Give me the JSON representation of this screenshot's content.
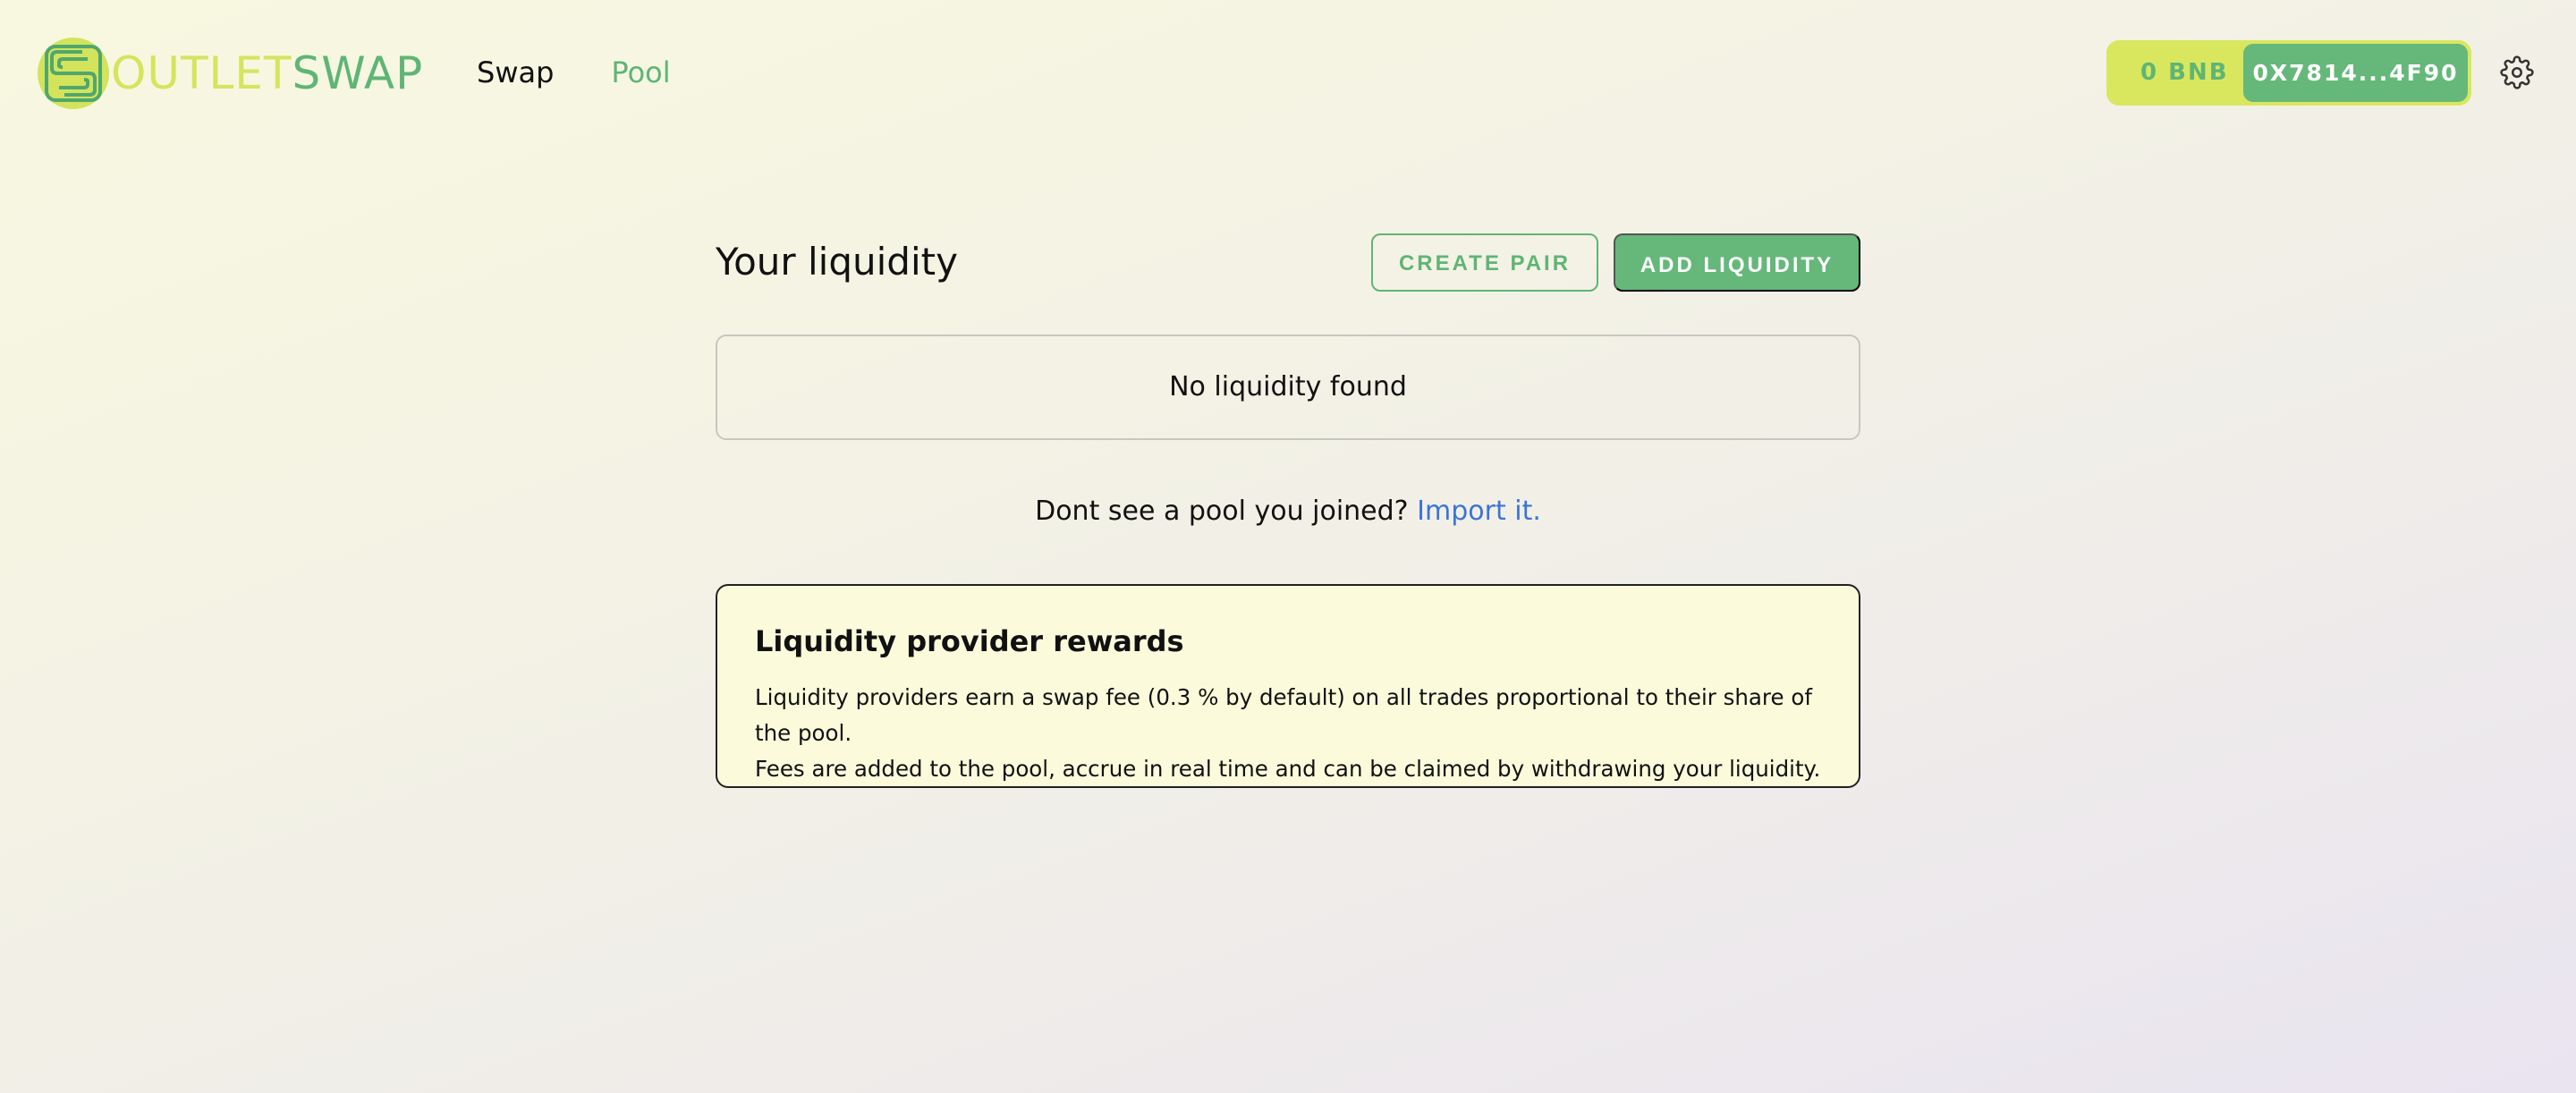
{
  "header": {
    "logo_text_part1": "OUTLET",
    "logo_text_part2": "SWAP",
    "nav": [
      {
        "label": "Swap",
        "active": false
      },
      {
        "label": "Pool",
        "active": true
      }
    ],
    "wallet": {
      "balance": "0 BNB",
      "address": "0X7814...4F90"
    },
    "settings_icon": "gear-icon"
  },
  "main": {
    "title": "Your liquidity",
    "create_pair_label": "CREATE PAIR",
    "add_liquidity_label": "ADD LIQUIDITY",
    "empty_text": "No liquidity found",
    "import_prompt": "Dont see a pool you joined?",
    "import_link": "Import it.",
    "rewards": {
      "title": "Liquidity provider rewards",
      "line1": "Liquidity providers earn a swap fee (0.3 % by default) on all trades proportional to their share of the pool.",
      "line2": "Fees are added to the pool, accrue in real time and can be claimed by withdrawing your liquidity."
    }
  },
  "colors": {
    "brand_green": "#5fb575",
    "brand_lime": "#d6e45e",
    "link_blue": "#3b74d8"
  }
}
